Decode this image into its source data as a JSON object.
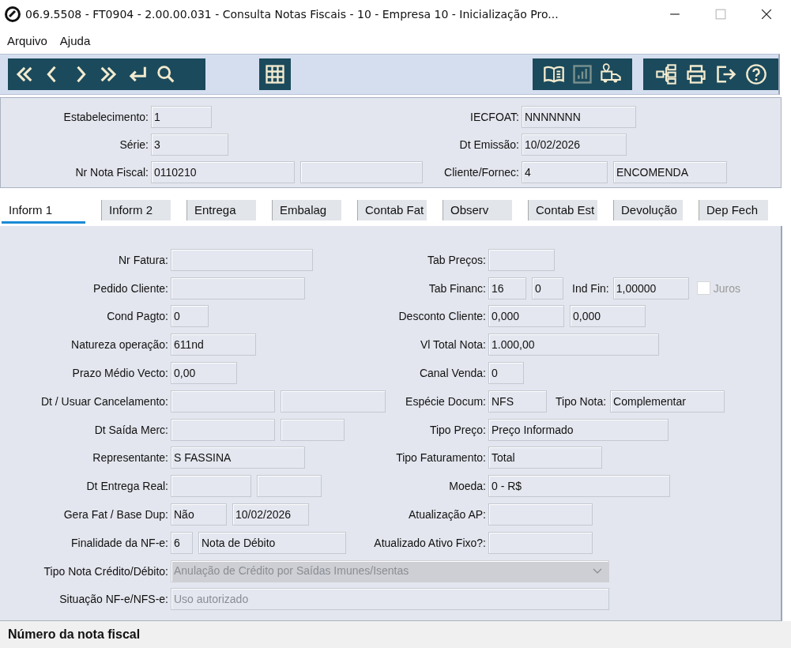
{
  "window": {
    "title": "06.9.5508 - FT0904 - 2.00.00.031 - Consulta Notas Fiscais - 10 - Empresa 10 - Inicialização Pro..."
  },
  "menu": [
    "Arquivo",
    "Ajuda"
  ],
  "toolbar": [
    {
      "disabled": false
    },
    {
      "disabled": false
    },
    {
      "disabled": false
    },
    {
      "disabled": false
    },
    {
      "disabled": false
    },
    {
      "disabled": false
    },
    {
      "disabled": false
    },
    {
      "disabled": false
    },
    {
      "disabled": true
    },
    {
      "disabled": false
    },
    {
      "disabled": false
    },
    {
      "disabled": false
    },
    {
      "disabled": false
    },
    {
      "disabled": false
    }
  ],
  "header": [
    {
      "left": {
        "label": "Estabelecimento:",
        "fields": [
          {
            "kind": "field",
            "value": "1"
          }
        ]
      },
      "right": {
        "label": "IECFOAT:",
        "fields": [
          {
            "kind": "field",
            "value": "NNNNNNN"
          }
        ]
      }
    },
    {
      "left": {
        "label": "Série:",
        "fields": [
          {
            "kind": "field",
            "value": "3"
          }
        ]
      },
      "right": {
        "label": "Dt Emissão:",
        "fields": [
          {
            "kind": "field",
            "value": "10/02/2026"
          }
        ]
      }
    },
    {
      "left": {
        "label": "Nr Nota Fiscal:",
        "fields": [
          {
            "kind": "field",
            "value": "0110210"
          },
          {
            "kind": "blank"
          }
        ]
      },
      "right": {
        "label": "Cliente/Fornec:",
        "fields": [
          {
            "kind": "field",
            "value": "4"
          },
          {
            "kind": "field",
            "value": "ENCOMENDA"
          }
        ]
      }
    }
  ],
  "tabs": [
    {
      "label": "Inform 1",
      "selected": true
    },
    {
      "label": "Inform 2",
      "selected": false
    },
    {
      "label": "Entrega",
      "selected": false
    },
    {
      "label": "Embalag",
      "selected": false
    },
    {
      "label": "Contab Fat",
      "selected": false
    },
    {
      "label": "Observ",
      "selected": false
    },
    {
      "label": "Contab Est",
      "selected": false
    },
    {
      "label": "Devolução",
      "selected": false
    },
    {
      "label": "Dep Fech",
      "selected": false
    }
  ],
  "form": [
    {
      "left": {
        "label": "Nr Fatura:",
        "fields": [
          {
            "kind": "blank"
          }
        ]
      },
      "right": {
        "label": "Tab Preços:",
        "fields": [
          {
            "kind": "blank"
          }
        ]
      }
    },
    {
      "left": {
        "label": "Pedido Cliente:",
        "fields": [
          {
            "kind": "blank"
          }
        ]
      },
      "right": {
        "label": "Tab Financ:",
        "fields": [
          {
            "kind": "field",
            "value": "16"
          },
          {
            "kind": "field",
            "value": "0"
          },
          {
            "kind": "label",
            "value": "Ind Fin:"
          },
          {
            "kind": "field",
            "value": "1,00000"
          },
          {
            "kind": "checkbox",
            "value": "Juros",
            "checked": false
          }
        ]
      }
    },
    {
      "left": {
        "label": "Cond Pagto:",
        "fields": [
          {
            "kind": "field",
            "value": "0"
          }
        ]
      },
      "right": {
        "label": "Desconto Cliente:",
        "fields": [
          {
            "kind": "field",
            "value": "0,000"
          },
          {
            "kind": "field",
            "value": "0,000"
          }
        ]
      }
    },
    {
      "left": {
        "label": "Natureza operação:",
        "fields": [
          {
            "kind": "field",
            "value": "611nd"
          }
        ]
      },
      "right": {
        "label": "Vl Total Nota:",
        "fields": [
          {
            "kind": "field",
            "value": "1.000,00"
          }
        ]
      }
    },
    {
      "left": {
        "label": "Prazo Médio Vecto:",
        "fields": [
          {
            "kind": "field",
            "value": "0,00"
          }
        ]
      },
      "right": {
        "label": "Canal Venda:",
        "fields": [
          {
            "kind": "field",
            "value": "0"
          }
        ]
      }
    },
    {
      "left": {
        "label": "Dt / Usuar Cancelamento:",
        "fields": [
          {
            "kind": "blank"
          },
          {
            "kind": "blank"
          }
        ]
      },
      "right": {
        "label": "Espécie Docum:",
        "fields": [
          {
            "kind": "field",
            "value": "NFS"
          },
          {
            "kind": "label",
            "value": "Tipo Nota:"
          },
          {
            "kind": "field",
            "value": "Complementar"
          }
        ]
      }
    },
    {
      "left": {
        "label": "Dt Saída Merc:",
        "fields": [
          {
            "kind": "blank"
          },
          {
            "kind": "blank"
          }
        ]
      },
      "right": {
        "label": "Tipo Preço:",
        "fields": [
          {
            "kind": "field",
            "value": "Preço Informado"
          }
        ]
      }
    },
    {
      "left": {
        "label": "Representante:",
        "fields": [
          {
            "kind": "field",
            "value": "S FASSINA"
          }
        ]
      },
      "right": {
        "label": "Tipo Faturamento:",
        "fields": [
          {
            "kind": "field",
            "value": "Total"
          }
        ]
      }
    },
    {
      "left": {
        "label": "Dt Entrega Real:",
        "fields": [
          {
            "kind": "blank"
          },
          {
            "kind": "blank"
          }
        ]
      },
      "right": {
        "label": "Moeda:",
        "fields": [
          {
            "kind": "field",
            "value": "0 - R$"
          }
        ]
      }
    },
    {
      "left": {
        "label": "Gera Fat / Base Dup:",
        "fields": [
          {
            "kind": "field",
            "value": "Não"
          },
          {
            "kind": "field",
            "value": "10/02/2026"
          }
        ]
      },
      "right": {
        "label": "Atualização AP:",
        "fields": [
          {
            "kind": "blank"
          }
        ]
      }
    },
    {
      "left": {
        "label": "Finalidade da NF-e:",
        "fields": [
          {
            "kind": "field",
            "value": "6"
          },
          {
            "kind": "field",
            "value": "Nota de Débito"
          }
        ]
      },
      "right": {
        "label": "Atualizado Ativo Fixo?:",
        "fields": [
          {
            "kind": "blank"
          }
        ]
      }
    },
    {
      "left": {
        "label": "Tipo Nota Crédito/Débito:",
        "fields": [
          {
            "kind": "dropdown",
            "value": "Anulação de Crédito por Saídas Imunes/Isentas"
          }
        ]
      }
    },
    {
      "left": {
        "label": "Situação NF-e/NFS-e:",
        "fields": [
          {
            "kind": "muted",
            "value": "Uso autorizado"
          }
        ]
      }
    }
  ],
  "status_bar": "Número da nota fiscal"
}
